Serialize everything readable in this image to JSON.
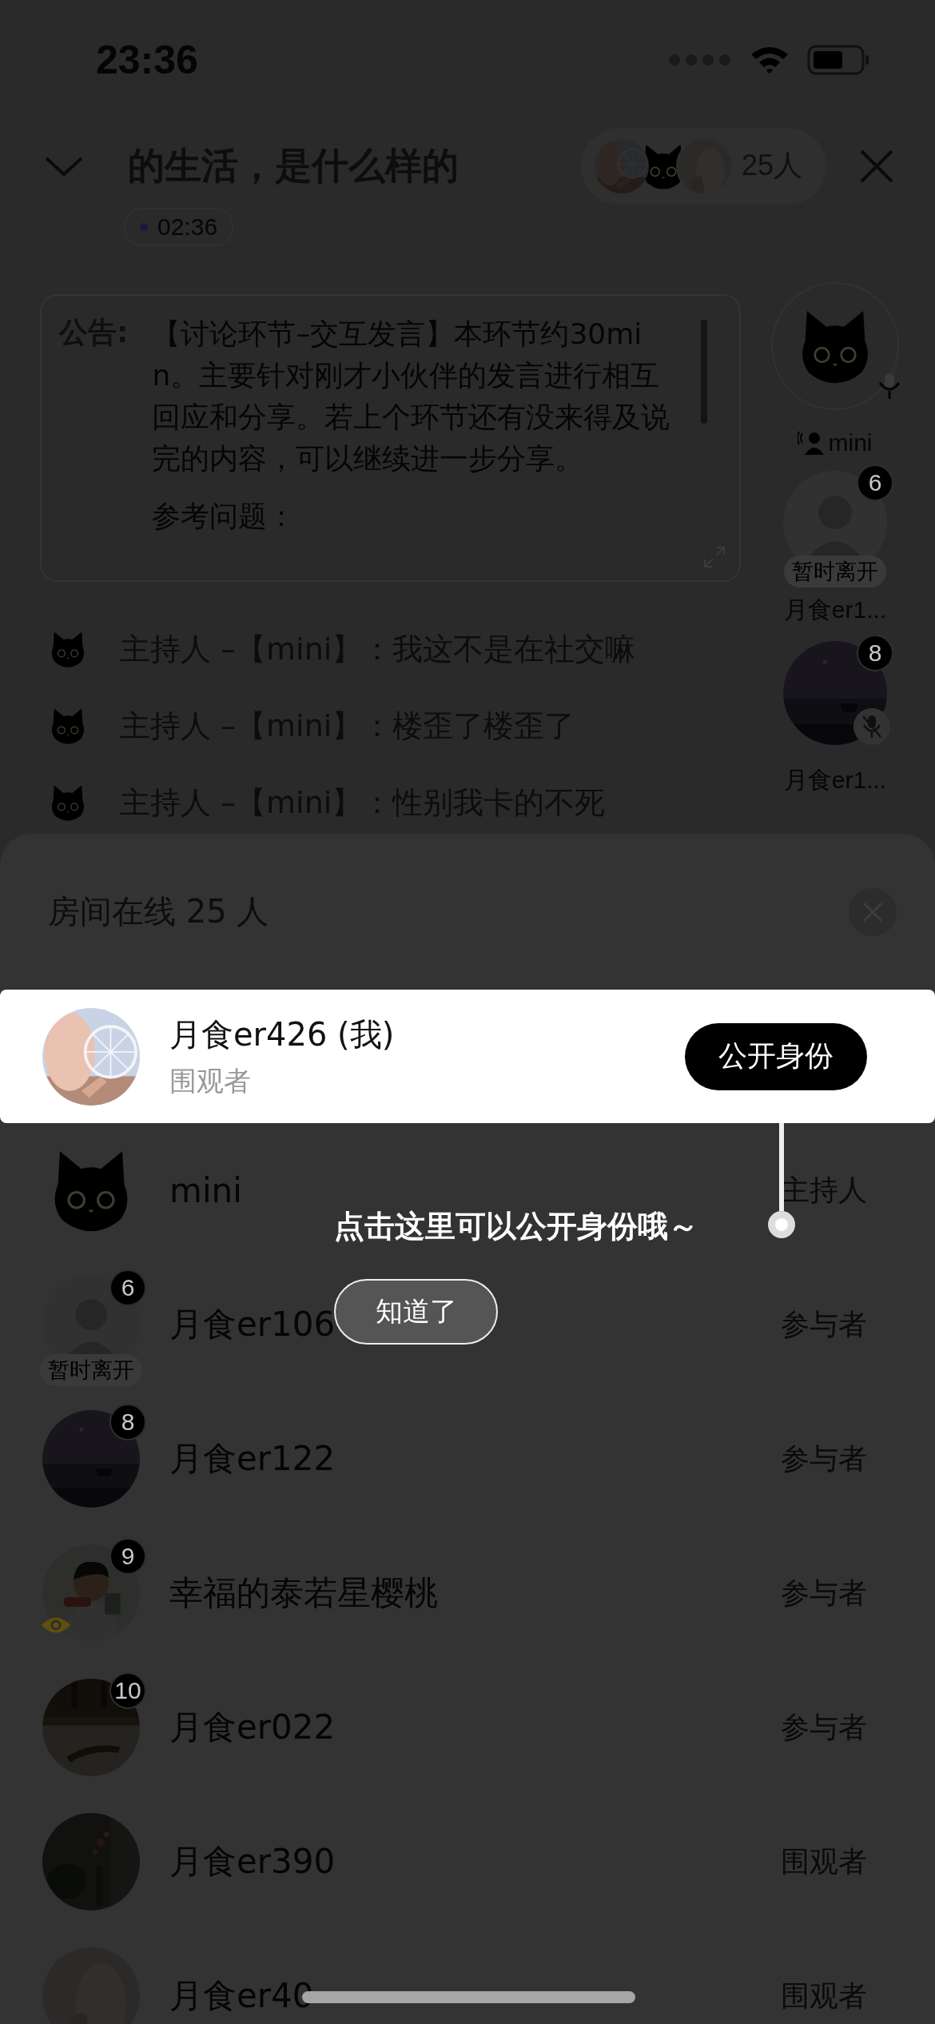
{
  "status_bar": {
    "time": "23:36"
  },
  "header": {
    "title": "的生活，是什么样的",
    "online_count": "25人",
    "timer": "02:36"
  },
  "notice": {
    "label": "公告:",
    "text": "【讨论环节–交互发言】本环节约30min。主要针对刚才小伙伴的发言进行相互回应和分享。若上个环节还有没来得及说完的内容，可以继续进一步分享。",
    "extra": "参考问题："
  },
  "speakers": [
    {
      "avatar": {
        "kind": "cat"
      },
      "name": "mini",
      "host": true,
      "mic": {
        "kind": "on"
      }
    },
    {
      "avatar": {
        "kind": "default"
      },
      "badge": "6",
      "status": "暂时离开",
      "name": "月食er1...",
      "host": false
    },
    {
      "badge": "8",
      "mic": {
        "kind": "off"
      },
      "name": "月食er1...",
      "host": false
    }
  ],
  "chat": [
    {
      "text": "主持人 –【mini】：我这不是在社交嘛"
    },
    {
      "text": "主持人 –【mini】：楼歪了楼歪了"
    },
    {
      "text": "主持人 –【mini】：性别我卡的不死"
    }
  ],
  "sheet": {
    "title": "房间在线 25 人",
    "members": [
      {
        "kind": "self",
        "name": "月食er426 (我)",
        "role": "围观者",
        "action": "公开身份",
        "eye": false
      },
      {
        "kind": "member",
        "name": "mini",
        "role": "主持人",
        "avatar": {
          "kind": "cat"
        },
        "eye": false
      },
      {
        "kind": "member",
        "name": "月食er106",
        "role": "参与者",
        "avatar": {
          "kind": "default"
        },
        "badge": "6",
        "status": "暂时离开",
        "eye": false
      },
      {
        "kind": "member",
        "name": "月食er122",
        "role": "参与者",
        "badge": "8",
        "eye": false
      },
      {
        "kind": "member",
        "name": "幸福的泰若星樱桃",
        "role": "参与者",
        "badge": "9",
        "eye": true
      },
      {
        "kind": "member",
        "name": "月食er022",
        "role": "参与者",
        "badge": "10",
        "eye": false
      },
      {
        "kind": "member",
        "name": "月食er390",
        "role": "围观者",
        "eye": false
      },
      {
        "kind": "member",
        "name": "月食er40",
        "role": "围观者",
        "eye": false
      }
    ]
  },
  "guide": {
    "tip": "点击这里可以公开身份哦～",
    "button": "知道了"
  }
}
